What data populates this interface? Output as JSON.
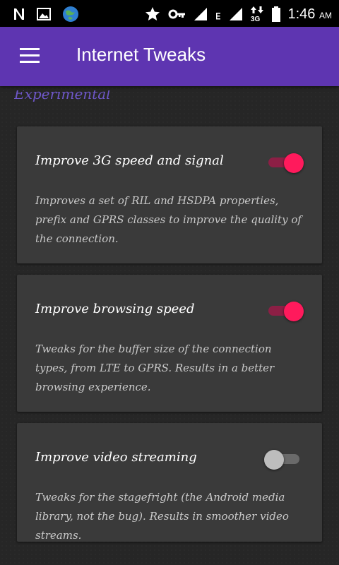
{
  "status_bar": {
    "time": "1:46",
    "ampm": "AM",
    "icons": [
      "notification-n-icon",
      "image-icon",
      "globe-icon",
      "star-icon",
      "key-icon",
      "signal-icon",
      "e-network-icon",
      "signal-icon",
      "3g-data-icon",
      "battery-icon"
    ]
  },
  "app_bar": {
    "title": "Internet Tweaks",
    "menu_icon": "hamburger-menu-icon"
  },
  "section": {
    "header": "Experimental"
  },
  "cards": [
    {
      "title": "Improve 3G speed and signal",
      "description": "Improves a set of RIL and HSDPA properties, prefix and GPRS classes to improve the quality of the connection.",
      "enabled": true
    },
    {
      "title": "Improve browsing speed",
      "description": "Tweaks for the buffer size of the connection types, from LTE to GPRS. Results in a better browsing experience.",
      "enabled": true
    },
    {
      "title": "Improve video streaming",
      "description": "Tweaks for the stagefright (the Android media library, not the bug). Results in smoother video streams.",
      "enabled": false
    }
  ],
  "colors": {
    "app_bar": "#5e35b1",
    "switch_on": "#ff1a5c",
    "switch_off": "#bdbdbd",
    "card_bg": "#3a3a3a"
  }
}
